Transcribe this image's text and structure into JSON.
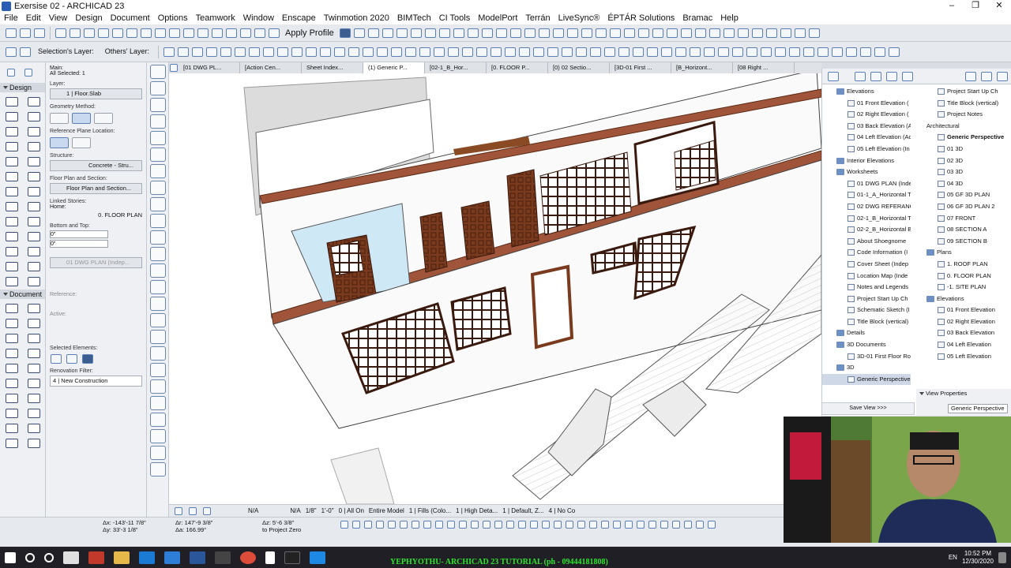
{
  "window": {
    "title": "Exersise 02 - ARCHICAD 23",
    "controls": [
      "–",
      "❐",
      "✕"
    ]
  },
  "menu": [
    "File",
    "Edit",
    "View",
    "Design",
    "Document",
    "Options",
    "Teamwork",
    "Window",
    "Enscape",
    "Twinmotion 2020",
    "BIMTech",
    "CI Tools",
    "ModelPort",
    "Terrán",
    "LiveSync®",
    "ÉPTÁR Solutions",
    "Bramac",
    "Help"
  ],
  "toolbar": {
    "apply_profile": "Apply Profile",
    "selections_layer": "Selection's Layer:",
    "others_layer": "Others' Layer:"
  },
  "toolbox": {
    "design": "Design",
    "document": "Document"
  },
  "infobox": {
    "main": "Main:",
    "all_selected": "All Selected: 1",
    "layer_label": "Layer:",
    "layer_value": "1 | Floor.Slab",
    "geometry_method": "Geometry Method:",
    "reference_plane": "Reference Plane Location:",
    "structure_label": "Structure:",
    "structure_value": "Concrete - Stru...",
    "floorplan_label": "Floor Plan and Section:",
    "floorplan_value": "Floor Plan and Section...",
    "linked_stories": "Linked Stories:",
    "home": "Home:",
    "home_value": "0. FLOOR PLAN",
    "bottom_top": "Bottom and Top:",
    "top_value": "0\"",
    "bottom_value": "0\"",
    "dwg_field": "01 DWG PLAN (Indep...",
    "reference": "Reference:",
    "active": "Active:",
    "selected_elements": "Selected Elements:",
    "renovation_filter": "Renovation Filter:",
    "renovation_value": "4 | New Construction"
  },
  "tabs": [
    "[01 DWG PL...",
    "[Action Cen...",
    "Sheet Index...",
    "(1) Generic P...",
    "[02-1_B_Hor...",
    "[0. FLOOR P...",
    "[0) 02 Sectio...",
    "[3D-01 First ...",
    "[B_Horizont...",
    "[08 Right ..."
  ],
  "active_tab_index": 3,
  "status": {
    "na1": "N/A",
    "na2": "N/A",
    "scale": "1/8\"",
    "dim": "1'-0\"",
    "layers": "0 | All On",
    "model": "Entire Model",
    "fills": "1 | Fills (Colo...",
    "detail": "1 | High Deta...",
    "default": "1 | Default, Z...",
    "no": "4 | No Co"
  },
  "coords": {
    "dx": "Δx: -143'-11 7/8\"",
    "dy": "Δy: 33'-3 1/8\"",
    "dr": "Δr: 147'-9 3/8\"",
    "da": "Δa: 166.99°",
    "dz": "Δz: 5'-6 3/8\"",
    "to": "to Project Zero"
  },
  "navigator_left": [
    {
      "text": "Elevations",
      "type": "folder",
      "indent": 1
    },
    {
      "text": "01 Front Elevation (",
      "type": "leaf",
      "indent": 2
    },
    {
      "text": "02 Right Elevation (",
      "type": "leaf",
      "indent": 2
    },
    {
      "text": "03 Back Elevation (A",
      "type": "leaf",
      "indent": 2
    },
    {
      "text": "04 Left Elevation (Ad",
      "type": "leaf",
      "indent": 2
    },
    {
      "text": "05 Left Elevation (In",
      "type": "leaf",
      "indent": 2
    },
    {
      "text": "Interior Elevations",
      "type": "folder",
      "indent": 1
    },
    {
      "text": "Worksheets",
      "type": "folder",
      "indent": 1
    },
    {
      "text": "01 DWG PLAN (Inde",
      "type": "leaf",
      "indent": 2
    },
    {
      "text": "01-1_A_Horizontal T",
      "type": "leaf",
      "indent": 2
    },
    {
      "text": "02 DWG REFERANC",
      "type": "leaf",
      "indent": 2
    },
    {
      "text": "02-1_B_Horizontal T",
      "type": "leaf",
      "indent": 2
    },
    {
      "text": "02-2_B_Horizontal B",
      "type": "leaf",
      "indent": 2
    },
    {
      "text": "About Shoegnome",
      "type": "leaf",
      "indent": 2
    },
    {
      "text": "Code Information (I",
      "type": "leaf",
      "indent": 2
    },
    {
      "text": "Cover Sheet (Indep",
      "type": "leaf",
      "indent": 2
    },
    {
      "text": "Location Map (Inde",
      "type": "leaf",
      "indent": 2
    },
    {
      "text": "Notes and Legends",
      "type": "leaf",
      "indent": 2
    },
    {
      "text": "Project Start Up Ch",
      "type": "leaf",
      "indent": 2
    },
    {
      "text": "Schematic Sketch (I",
      "type": "leaf",
      "indent": 2
    },
    {
      "text": "Title Block (vertical)",
      "type": "leaf",
      "indent": 2
    },
    {
      "text": "Details",
      "type": "folder",
      "indent": 1
    },
    {
      "text": "3D Documents",
      "type": "folder",
      "indent": 1
    },
    {
      "text": "3D-01 First Floor Ro",
      "type": "leaf",
      "indent": 2
    },
    {
      "text": "3D",
      "type": "folder",
      "indent": 1
    },
    {
      "text": "Generic Perspective",
      "type": "leaf",
      "indent": 2,
      "selected": true
    }
  ],
  "navigator_right": [
    {
      "text": "Project Start Up Ch",
      "type": "leaf",
      "indent": 1
    },
    {
      "text": "Title Block (vertical)",
      "type": "leaf",
      "indent": 1
    },
    {
      "text": "Project Notes",
      "type": "leaf",
      "indent": 1
    },
    {
      "text": "Architectural",
      "type": "plain",
      "indent": 0
    },
    {
      "text": "Generic Perspective",
      "type": "leaf",
      "indent": 1,
      "bold": true
    },
    {
      "text": "01 3D",
      "type": "leaf",
      "indent": 1
    },
    {
      "text": "02 3D",
      "type": "leaf",
      "indent": 1
    },
    {
      "text": "03 3D",
      "type": "leaf",
      "indent": 1
    },
    {
      "text": "04 3D",
      "type": "leaf",
      "indent": 1
    },
    {
      "text": "05 GF 3D PLAN",
      "type": "leaf",
      "indent": 1
    },
    {
      "text": "06 GF 3D PLAN 2",
      "type": "leaf",
      "indent": 1
    },
    {
      "text": "07 FRONT",
      "type": "leaf",
      "indent": 1
    },
    {
      "text": "08 SECTION A",
      "type": "leaf",
      "indent": 1
    },
    {
      "text": "09 SECTION B",
      "type": "leaf",
      "indent": 1
    },
    {
      "text": "Plans",
      "type": "folder",
      "indent": 0
    },
    {
      "text": "1. ROOF PLAN",
      "type": "leaf",
      "indent": 1
    },
    {
      "text": "0. FLOOR PLAN",
      "type": "leaf",
      "indent": 1
    },
    {
      "text": "-1. SITE PLAN",
      "type": "leaf",
      "indent": 1
    },
    {
      "text": "Elevations",
      "type": "folder",
      "indent": 0
    },
    {
      "text": "01 Front Elevation",
      "type": "leaf",
      "indent": 1
    },
    {
      "text": "02 Right Elevation",
      "type": "leaf",
      "indent": 1
    },
    {
      "text": "03 Back Elevation",
      "type": "leaf",
      "indent": 1
    },
    {
      "text": "04 Left Elevation",
      "type": "leaf",
      "indent": 1
    },
    {
      "text": "05 Left Elevation",
      "type": "leaf",
      "indent": 1
    }
  ],
  "save_view": "Save View >>>",
  "view_properties": {
    "header": "View Properties",
    "value": "Generic Perspective"
  },
  "taskbar": {
    "banner": "YEPHYOTHU- ARCHICAD 23 TUTORIAL (ph - 09444181808)",
    "lang": "EN",
    "time": "10:52 PM",
    "date": "12/30/2020"
  },
  "colors": {
    "accent": "#2b5db3",
    "wood": "#7a3a1e",
    "banner": "#2ee52e"
  }
}
